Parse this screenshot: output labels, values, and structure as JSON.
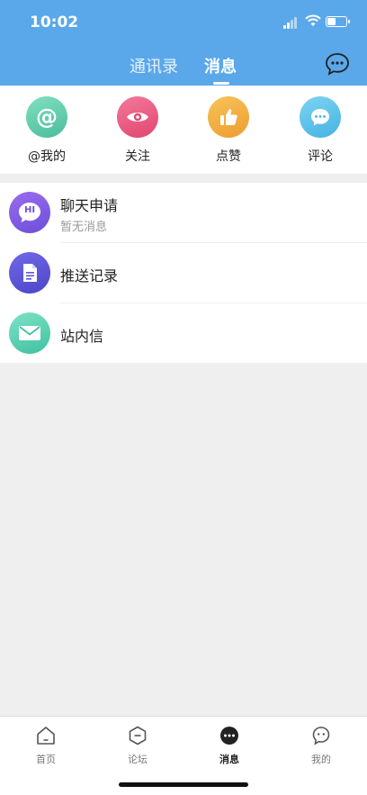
{
  "status_bar": {
    "time": "10:02"
  },
  "header": {
    "tabs": [
      {
        "label": "通讯录",
        "active": false
      },
      {
        "label": "消息",
        "active": true
      }
    ],
    "chat_icon": "chat-bubble-icon"
  },
  "quick_actions": [
    {
      "label": "@我的",
      "icon": "at-icon",
      "color": "#5ec9a7"
    },
    {
      "label": "关注",
      "icon": "eye-icon",
      "color": "#e94e7a"
    },
    {
      "label": "点赞",
      "icon": "thumbs-up-icon",
      "color": "#f2a93b"
    },
    {
      "label": "评论",
      "icon": "comment-icon",
      "color": "#56bde8"
    }
  ],
  "message_list": [
    {
      "title": "聊天申请",
      "subtitle": "暂无消息",
      "icon": "hi-chat-icon",
      "color": "#7a5ae0",
      "icon_text": "HI"
    },
    {
      "title": "推送记录",
      "icon": "document-icon",
      "color": "#5a55d9"
    },
    {
      "title": "站内信",
      "icon": "envelope-icon",
      "color": "#52cfae"
    }
  ],
  "tab_bar": [
    {
      "label": "首页",
      "icon": "home-icon",
      "active": false
    },
    {
      "label": "论坛",
      "icon": "forum-icon",
      "active": false
    },
    {
      "label": "消息",
      "icon": "message-icon",
      "active": true
    },
    {
      "label": "我的",
      "icon": "profile-icon",
      "active": false
    }
  ]
}
